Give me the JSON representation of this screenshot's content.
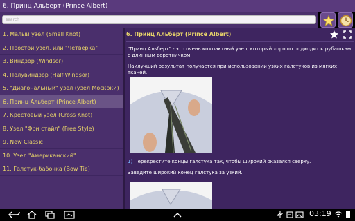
{
  "app": {
    "title": "6. Принц Альберт (Prince Albert)"
  },
  "search": {
    "placeholder": "search"
  },
  "sidebar": {
    "items": [
      {
        "label": "1. Малый узел (Small Knot)"
      },
      {
        "label": "2. Простой узел, или \"Четверка\""
      },
      {
        "label": "3. Виндзор (Windsor)"
      },
      {
        "label": "4. Полувиндзор (Half-Windsor)"
      },
      {
        "label": "5. \"Диагональный\" узел (узел Москоки)"
      },
      {
        "label": "6. Принц Альберт (Prince Albert)"
      },
      {
        "label": "7. Крестовый узел (Cross Knot)"
      },
      {
        "label": "8. Узел \"Фри стайл\" (Free Style)"
      },
      {
        "label": "9. New Classic"
      },
      {
        "label": "10. Узел \"Американский\""
      },
      {
        "label": "11. Галстук-бабочка (Bow Tie)"
      }
    ],
    "selected_index": 5
  },
  "content": {
    "title": "6. Принц Альберт (Prince Albert)",
    "intro": "\"Принц Альберт\" - это очень компактный узел, который хорошо подходит к рубашкам с длинным воротничком.",
    "best_result": "Наилучший результат получается при использовании узких галстуков из мягких тканей.",
    "step1_number": "1)",
    "step1_text": "Перекрестите концы галстука так, чтобы широкий оказался сверху.",
    "step1_followup": "Заведите широкий конец галстука за узкий."
  },
  "statusbar": {
    "time": "03:19"
  },
  "colors": {
    "accent": "#e8d46a",
    "panel": "#4a2f6c",
    "content_bg": "#3e2560",
    "selected": "#6a5386"
  }
}
